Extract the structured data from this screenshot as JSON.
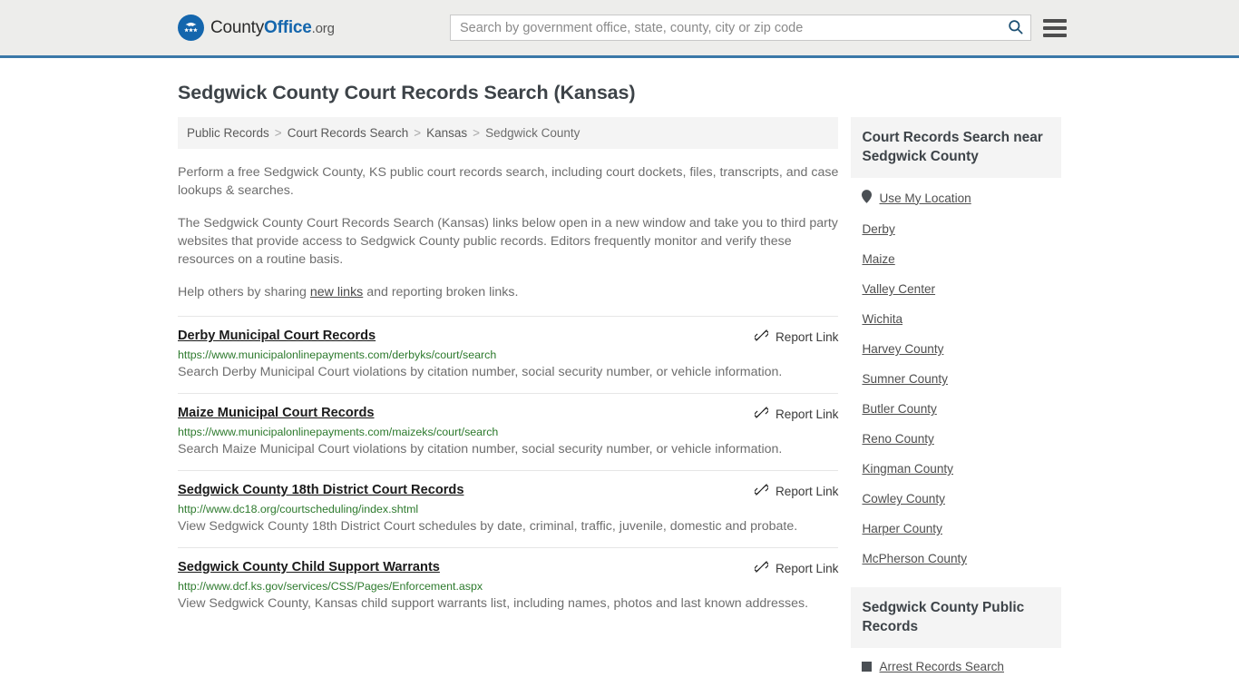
{
  "header": {
    "logo": {
      "part1": "County",
      "part2": "Office",
      "part3": ".org",
      "icon": "eagle-shield-icon"
    },
    "search": {
      "placeholder": "Search by government office, state, county, city or zip code",
      "value": "",
      "button_icon": "search-icon"
    },
    "menu_icon": "hamburger-menu-icon",
    "accent_color": "#3b78a8"
  },
  "page_title": "Sedgwick County Court Records Search (Kansas)",
  "breadcrumb": {
    "items": [
      {
        "label": "Public Records",
        "current": false
      },
      {
        "label": "Court Records Search",
        "current": false
      },
      {
        "label": "Kansas",
        "current": false
      },
      {
        "label": "Sedgwick County",
        "current": true
      }
    ],
    "separator": ">"
  },
  "intro": {
    "p1": "Perform a free Sedgwick County, KS public court records search, including court dockets, files, transcripts, and case lookups & searches.",
    "p2": "The Sedgwick County Court Records Search (Kansas) links below open in a new window and take you to third party websites that provide access to Sedgwick County public records. Editors frequently monitor and verify these resources on a routine basis.",
    "p3_before": "Help others by sharing ",
    "p3_link": "new links",
    "p3_after": " and reporting broken links."
  },
  "results": {
    "report_label": "Report Link",
    "report_icon": "broken-link-icon",
    "items": [
      {
        "title": "Derby Municipal Court Records",
        "url": "https://www.municipalonlinepayments.com/derbyks/court/search",
        "description": "Search Derby Municipal Court violations by citation number, social security number, or vehicle information."
      },
      {
        "title": "Maize Municipal Court Records",
        "url": "https://www.municipalonlinepayments.com/maizeks/court/search",
        "description": "Search Maize Municipal Court violations by citation number, social security number, or vehicle information."
      },
      {
        "title": "Sedgwick County 18th District Court Records",
        "url": "http://www.dc18.org/courtscheduling/index.shtml",
        "description": "View Sedgwick County 18th District Court schedules by date, criminal, traffic, juvenile, domestic and probate."
      },
      {
        "title": "Sedgwick County Child Support Warrants",
        "url": "http://www.dcf.ks.gov/services/CSS/Pages/Enforcement.aspx",
        "description": "View Sedgwick County, Kansas child support warrants list, including names, photos and last known addresses."
      }
    ]
  },
  "sidebar": {
    "nearby": {
      "heading": "Court Records Search near Sedgwick County",
      "use_my_location": {
        "label": "Use My Location",
        "icon": "map-pin-icon"
      },
      "links": [
        "Derby",
        "Maize",
        "Valley Center",
        "Wichita",
        "Harvey County",
        "Sumner County",
        "Butler County",
        "Reno County",
        "Kingman County",
        "Cowley County",
        "Harper County",
        "McPherson County"
      ]
    },
    "public_records": {
      "heading": "Sedgwick County Public Records",
      "links": [
        {
          "label": "Arrest Records Search",
          "icon": "square-bullet-icon"
        }
      ]
    }
  }
}
